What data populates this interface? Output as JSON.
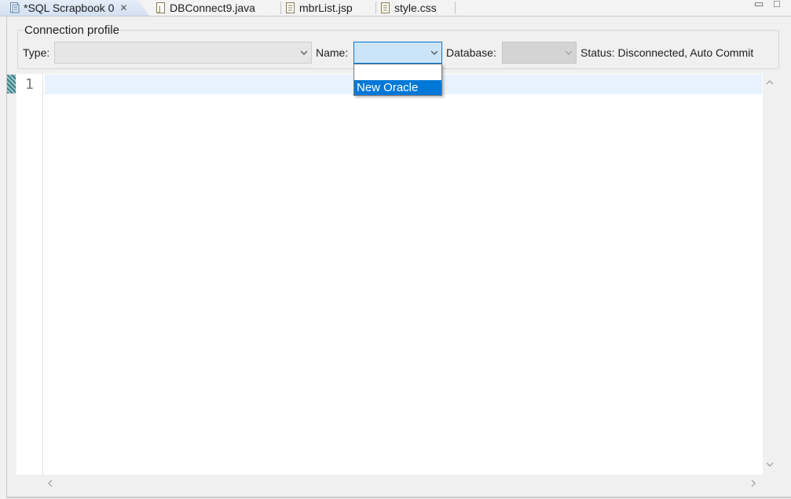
{
  "tabs": [
    {
      "label": "*SQL Scrapbook 0",
      "icon": "sql-scrapbook-icon",
      "active": true,
      "closable": true
    },
    {
      "label": "DBConnect9.java",
      "icon": "java-file-icon",
      "active": false
    },
    {
      "label": "mbrList.jsp",
      "icon": "jsp-file-icon",
      "active": false
    },
    {
      "label": "style.css",
      "icon": "css-file-icon",
      "active": false
    }
  ],
  "window_controls": {
    "minimize": "▭",
    "maximize": "□"
  },
  "connection_profile": {
    "title": "Connection profile",
    "type_label": "Type:",
    "type_value": "",
    "name_label": "Name:",
    "name_value": "",
    "database_label": "Database:",
    "database_value": "",
    "status": "Status: Disconnected, Auto Commit"
  },
  "name_dropdown": {
    "options": [
      "",
      "New Oracle"
    ],
    "highlighted": "New Oracle"
  },
  "editor": {
    "line_numbers": [
      "1"
    ],
    "content": ""
  },
  "colors": {
    "accent": "#0078d7",
    "current_line": "#e8f2fe",
    "tab_active": "#d3e0f1"
  }
}
